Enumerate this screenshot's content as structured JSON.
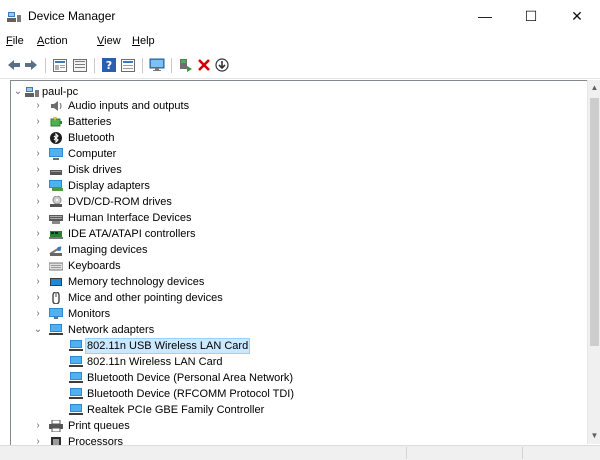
{
  "window": {
    "title": "Device Manager",
    "controls": {
      "minimize": "—",
      "maximize": "☐",
      "close": "✕"
    }
  },
  "menu": [
    {
      "name": "file",
      "accel": "F",
      "rest": "ile"
    },
    {
      "name": "action",
      "accel": "A",
      "rest": "ction"
    },
    {
      "name": "view",
      "accel": "V",
      "rest": "iew"
    },
    {
      "name": "help",
      "accel": "H",
      "rest": "elp"
    }
  ],
  "toolbar": {
    "back_icon": "arrow-left",
    "forward_icon": "arrow-right",
    "properties_icon": "properties-sheet",
    "update_driver_icon": "update-driver",
    "help_icon": "help-question",
    "view_icon": "view-device",
    "scan_icon": "scan-monitor",
    "enable_icon": "enable-device",
    "uninstall_icon": "uninstall-x",
    "download_icon": "download-circle"
  },
  "tree": {
    "root": "paul-pc",
    "items": [
      {
        "label": "Audio inputs and outputs",
        "icon": "speaker-icon",
        "expanded": false
      },
      {
        "label": "Batteries",
        "icon": "battery-icon",
        "expanded": false
      },
      {
        "label": "Bluetooth",
        "icon": "bluetooth-icon",
        "expanded": false
      },
      {
        "label": "Computer",
        "icon": "computer-icon",
        "expanded": false
      },
      {
        "label": "Disk drives",
        "icon": "disk-drive-icon",
        "expanded": false
      },
      {
        "label": "Display adapters",
        "icon": "display-adapter-icon",
        "expanded": false
      },
      {
        "label": "DVD/CD-ROM drives",
        "icon": "dvd-drive-icon",
        "expanded": false
      },
      {
        "label": "Human Interface Devices",
        "icon": "hid-icon",
        "expanded": false
      },
      {
        "label": "IDE ATA/ATAPI controllers",
        "icon": "ide-controller-icon",
        "expanded": false
      },
      {
        "label": "Imaging devices",
        "icon": "imaging-device-icon",
        "expanded": false
      },
      {
        "label": "Keyboards",
        "icon": "keyboard-icon",
        "expanded": false
      },
      {
        "label": "Memory technology devices",
        "icon": "memory-device-icon",
        "expanded": false
      },
      {
        "label": "Mice and other pointing devices",
        "icon": "mouse-icon",
        "expanded": false
      },
      {
        "label": "Monitors",
        "icon": "monitor-icon",
        "expanded": false
      },
      {
        "label": "Network adapters",
        "icon": "network-adapter-icon",
        "expanded": true
      },
      {
        "label": "Print queues",
        "icon": "printer-icon",
        "expanded": false
      },
      {
        "label": "Processors",
        "icon": "processor-icon",
        "expanded": false
      }
    ],
    "network_children": [
      {
        "label": "802.11n USB Wireless LAN Card",
        "selected": true
      },
      {
        "label": "802.11n Wireless LAN Card",
        "selected": false
      },
      {
        "label": "Bluetooth Device (Personal Area Network)",
        "selected": false
      },
      {
        "label": "Bluetooth Device (RFCOMM Protocol TDI)",
        "selected": false
      },
      {
        "label": "Realtek PCIe GBE Family Controller",
        "selected": false
      }
    ]
  },
  "colors": {
    "selection_bg": "#cce8ff",
    "selection_border": "#99d1ff",
    "uninstall_red": "#d40000",
    "enable_green": "#2e9e2e",
    "device_blue": "#1e88d4"
  }
}
